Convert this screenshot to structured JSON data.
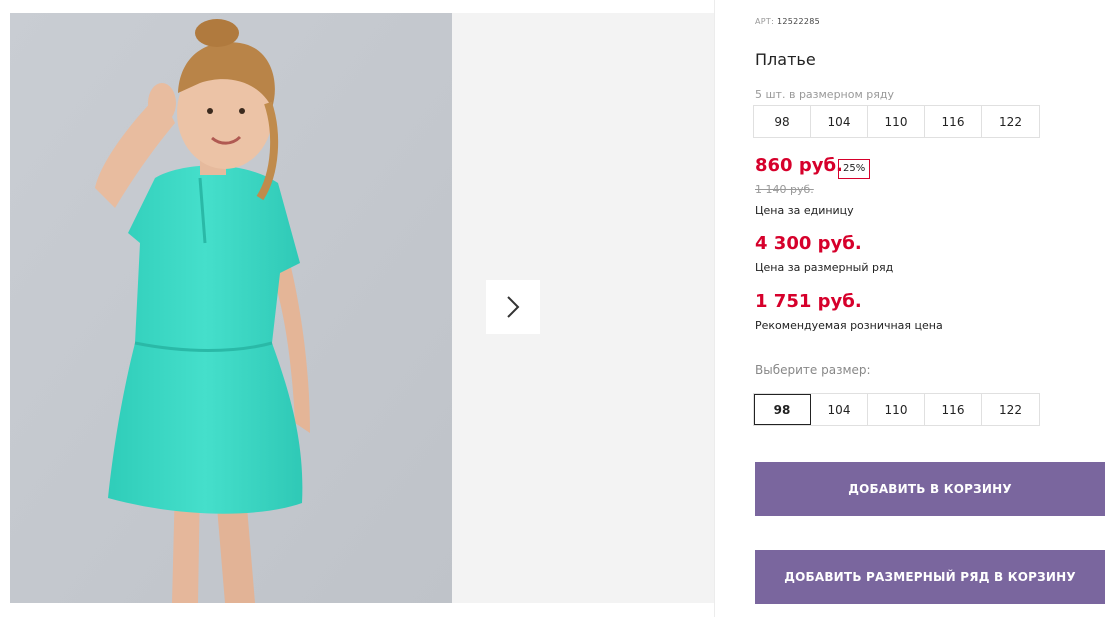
{
  "article": {
    "label": "АРТ:",
    "number": "12522285"
  },
  "product": {
    "title": "Платье"
  },
  "pack": {
    "note": "5 шт. в размерном ряду",
    "sizes": [
      "98",
      "104",
      "110",
      "116",
      "122"
    ]
  },
  "prices": {
    "unit": "860 руб.",
    "discount": "25%",
    "old": "1 140 руб.",
    "unit_caption": "Цена за единицу",
    "set": "4 300 руб.",
    "set_caption": "Цена за размерный ряд",
    "rrp": "1 751 руб.",
    "rrp_caption": "Рекомендуемая розничная цена"
  },
  "size_select": {
    "label": "Выберите размер:",
    "options": [
      "98",
      "104",
      "110",
      "116",
      "122"
    ],
    "selected": "98"
  },
  "buttons": {
    "add_to_cart": "ДОБАВИТЬ В КОРЗИНУ",
    "add_set_to_cart": "ДОБАВИТЬ РАЗМЕРНЫЙ РЯД В КОРЗИНУ"
  },
  "icons": {
    "next": "chevron-right-icon"
  },
  "colors": {
    "price": "#d6002b",
    "button": "#7a669e",
    "dress": "#3fd9c6"
  }
}
